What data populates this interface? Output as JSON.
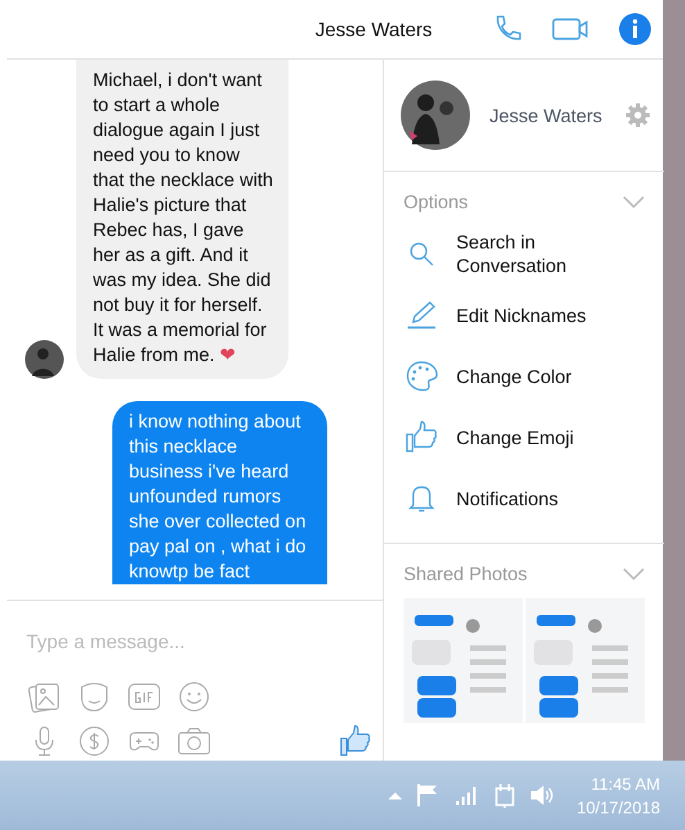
{
  "header": {
    "title": "Jesse Waters"
  },
  "messages": [
    {
      "kind": "received",
      "text": "Michael, i don't want to start a whole dialogue again I just need you to know that the necklace with Halie's picture that Rebec has, I gave her as a gift. And it was my idea. She did not buy it for herself. It was a memorial for Halie from me.",
      "emoji": "❤"
    },
    {
      "kind": "sent",
      "text": "i know nothing about this necklace business i've heard unfounded rumors she over collected on pay pal on , what i do knowtp be fact"
    }
  ],
  "composer": {
    "placeholder": "Type a message..."
  },
  "profile": {
    "name": "Jesse Waters"
  },
  "options": {
    "title": "Options",
    "items": [
      {
        "kind": "search",
        "label": "Search in Conversation"
      },
      {
        "kind": "edit",
        "label": "Edit Nicknames"
      },
      {
        "kind": "color",
        "label": "Change Color"
      },
      {
        "kind": "emoji",
        "label": "Change Emoji"
      },
      {
        "kind": "bell",
        "label": "Notifications"
      }
    ]
  },
  "shared_photos": {
    "title": "Shared Photos"
  },
  "taskbar": {
    "time": "11:45 AM",
    "date": "10/17/2018"
  }
}
